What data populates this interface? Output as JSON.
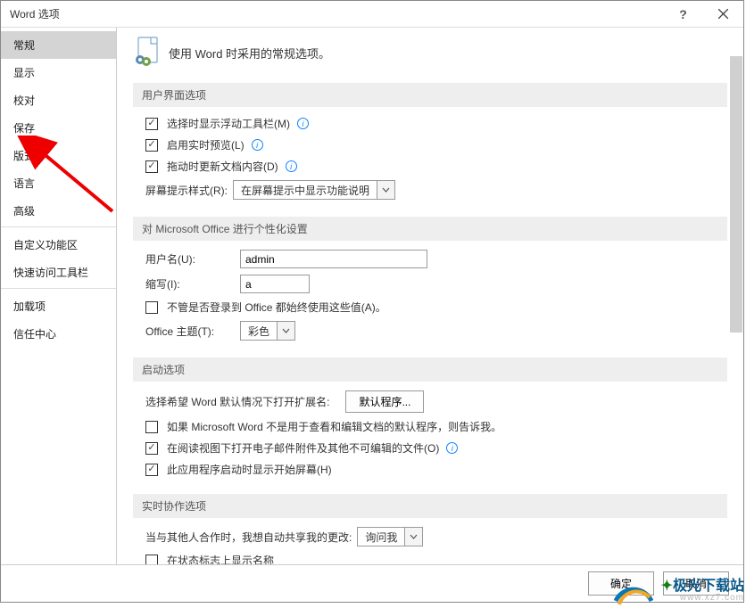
{
  "title": "Word 选项",
  "sidebar": {
    "items": [
      {
        "label": "常规"
      },
      {
        "label": "显示"
      },
      {
        "label": "校对"
      },
      {
        "label": "保存"
      },
      {
        "label": "版式"
      },
      {
        "label": "语言"
      },
      {
        "label": "高级"
      },
      {
        "label": "自定义功能区"
      },
      {
        "label": "快速访问工具栏"
      },
      {
        "label": "加载项"
      },
      {
        "label": "信任中心"
      }
    ]
  },
  "main": {
    "header": "使用 Word 时采用的常规选项。",
    "sections": [
      {
        "title": "用户界面选项",
        "items": {
          "show_mini_toolbar": "选择时显示浮动工具栏(M)",
          "enable_live_preview": "启用实时预览(L)",
          "update_on_drag": "拖动时更新文档内容(D)",
          "screentip_label": "屏幕提示样式(R):",
          "screentip_value": "在屏幕提示中显示功能说明"
        }
      },
      {
        "title": "对 Microsoft Office 进行个性化设置",
        "items": {
          "username_label": "用户名(U):",
          "username_value": "admin",
          "initials_label": "缩写(I):",
          "initials_value": "a",
          "always_use_values": "不管是否登录到 Office 都始终使用这些值(A)。",
          "theme_label": "Office 主题(T):",
          "theme_value": "彩色"
        }
      },
      {
        "title": "启动选项",
        "items": {
          "default_ext_label": "选择希望 Word 默认情况下打开扩展名:",
          "default_btn": "默认程序...",
          "not_default_program": "如果 Microsoft Word 不是用于查看和编辑文档的默认程序，则告诉我。",
          "open_reading_view": "在阅读视图下打开电子邮件附件及其他不可编辑的文件(O)",
          "show_start_screen": "此应用程序启动时显示开始屏幕(H)"
        }
      },
      {
        "title": "实时协作选项",
        "items": {
          "auto_share_label": "当与其他人合作时，我想自动共享我的更改:",
          "auto_share_value": "询问我",
          "show_names_on_flags": "在状态标志上显示名称"
        }
      }
    ]
  },
  "footer": {
    "ok": "确定",
    "cancel": "取消"
  },
  "watermark": {
    "brand": "极光下载站",
    "url": "www.xz7.com"
  }
}
